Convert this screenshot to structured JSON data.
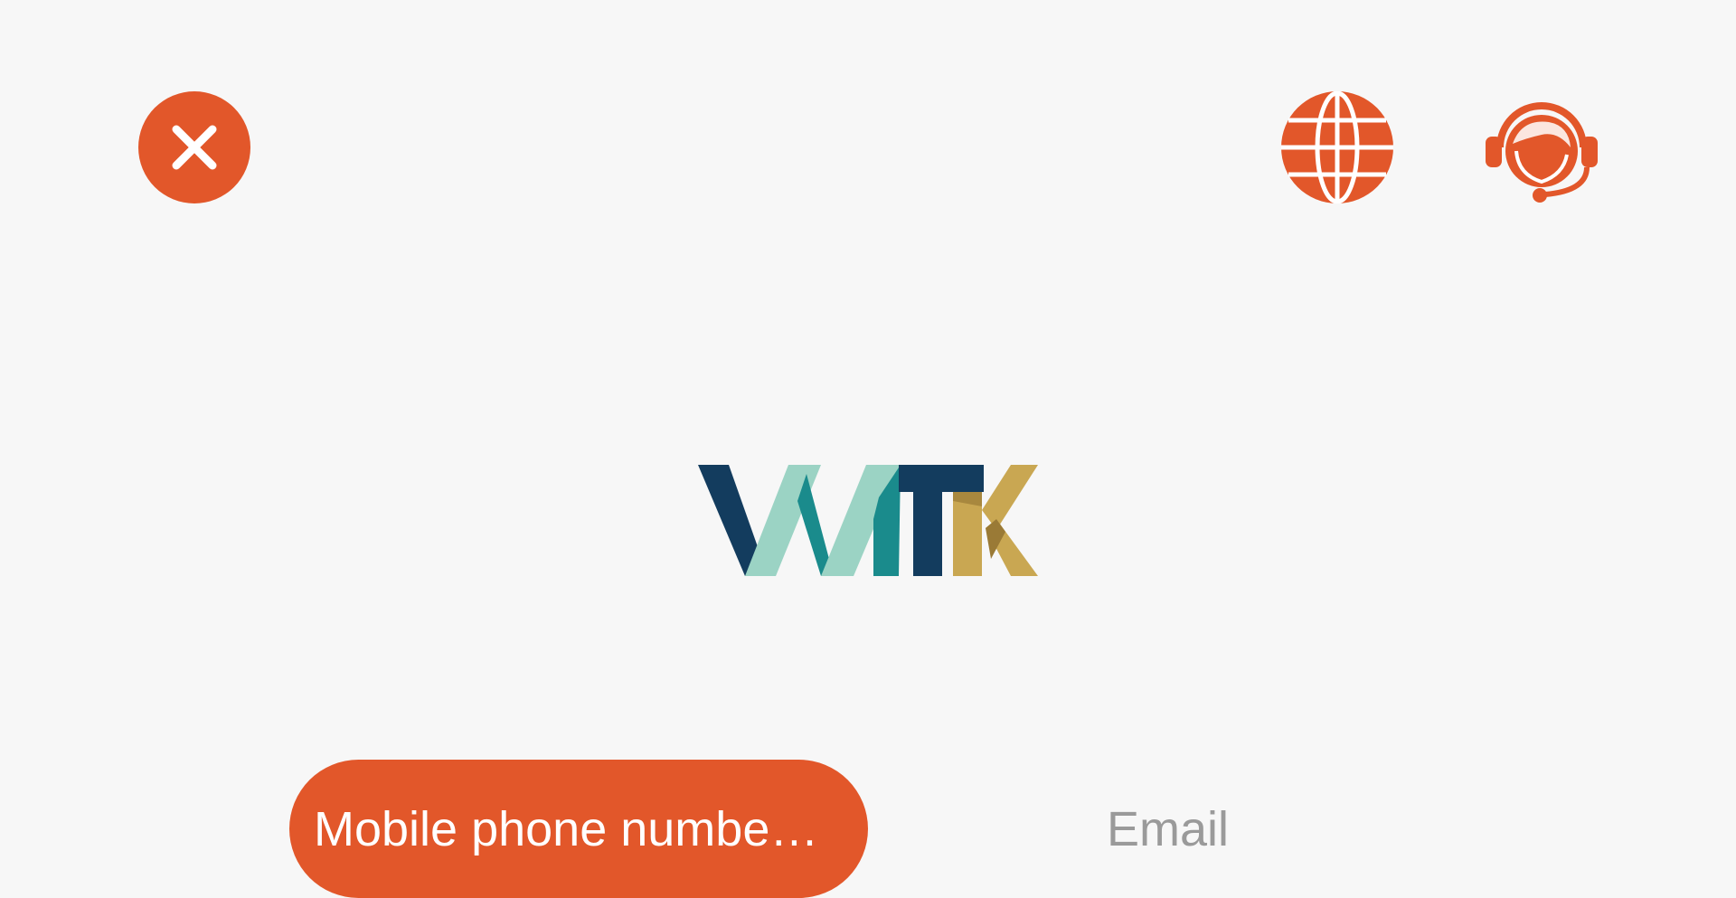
{
  "header": {
    "close_icon": "close-icon",
    "language_icon": "globe-icon",
    "support_icon": "headset-icon"
  },
  "logo": {
    "text": "WTK",
    "colors": {
      "navy": "#133c5e",
      "mint": "#9bd3c4",
      "teal": "#1a8b8c",
      "gold": "#c9a752"
    }
  },
  "login_tabs": {
    "phone_label": "Mobile phone number login",
    "email_label": "Email",
    "active": "phone"
  },
  "colors": {
    "accent": "#e2572a",
    "background": "#f7f7f7",
    "inactive_text": "#9a9a9a"
  }
}
